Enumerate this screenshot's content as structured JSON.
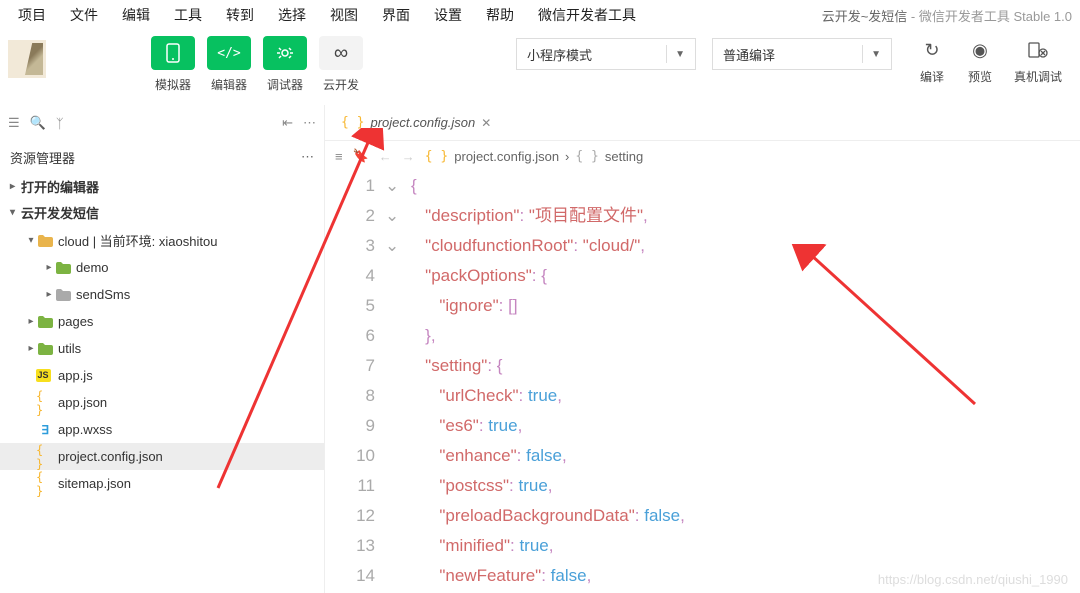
{
  "menu": [
    "项目",
    "文件",
    "编辑",
    "工具",
    "转到",
    "选择",
    "视图",
    "界面",
    "设置",
    "帮助",
    "微信开发者工具"
  ],
  "window_title": "云开发~发短信",
  "window_title_sub": " - 微信开发者工具 Stable 1.0",
  "toolbar": {
    "items": [
      {
        "icon": "phone",
        "label": "模拟器",
        "green": true
      },
      {
        "icon": "code",
        "label": "编辑器",
        "green": true
      },
      {
        "icon": "bug",
        "label": "调试器",
        "green": true
      },
      {
        "icon": "cloud",
        "label": "云开发",
        "green": false
      }
    ],
    "mode_dd": "小程序模式",
    "compile_dd": "普通编译",
    "actions": [
      "编译",
      "预览",
      "真机调试"
    ]
  },
  "explorer": {
    "title": "资源管理器",
    "sections": [
      {
        "label": "打开的编辑器",
        "expanded": false
      },
      {
        "label": "云开发发短信",
        "expanded": true
      }
    ],
    "tree": [
      {
        "d": 1,
        "chv": "▾",
        "ico": "folder",
        "label": "cloud | 当前环境: xiaoshitou"
      },
      {
        "d": 2,
        "chv": "▸",
        "ico": "folder-g",
        "label": "demo"
      },
      {
        "d": 2,
        "chv": "▸",
        "ico": "gray",
        "label": "sendSms"
      },
      {
        "d": 1,
        "chv": "▸",
        "ico": "folder-g",
        "label": "pages"
      },
      {
        "d": 1,
        "chv": "▸",
        "ico": "folder-g",
        "label": "utils"
      },
      {
        "d": 1,
        "chv": "",
        "ico": "js",
        "label": "app.js"
      },
      {
        "d": 1,
        "chv": "",
        "ico": "json",
        "label": "app.json"
      },
      {
        "d": 1,
        "chv": "",
        "ico": "wxss",
        "label": "app.wxss"
      },
      {
        "d": 1,
        "chv": "",
        "ico": "json",
        "label": "project.config.json",
        "sel": true
      },
      {
        "d": 1,
        "chv": "",
        "ico": "json",
        "label": "sitemap.json"
      }
    ]
  },
  "tab": {
    "icon": "{ }",
    "name": "project.config.json"
  },
  "breadcrumb": {
    "file": "project.config.json",
    "symbol_icon": "{ }",
    "symbol": "setting"
  },
  "code": {
    "lines": [
      {
        "n": 1,
        "fold": "⌄",
        "txt": [
          {
            "c": "p",
            "t": "{"
          }
        ]
      },
      {
        "n": 2,
        "txt": [
          {
            "c": "",
            "t": "   "
          },
          {
            "c": "s",
            "t": "\"description\""
          },
          {
            "c": "p",
            "t": ": "
          },
          {
            "c": "s",
            "t": "\"项目配置文件\""
          },
          {
            "c": "p",
            "t": ","
          }
        ]
      },
      {
        "n": 3,
        "txt": [
          {
            "c": "",
            "t": "   "
          },
          {
            "c": "s",
            "t": "\"cloudfunctionRoot\""
          },
          {
            "c": "p",
            "t": ": "
          },
          {
            "c": "s",
            "t": "\"cloud/\""
          },
          {
            "c": "p",
            "t": ","
          }
        ]
      },
      {
        "n": 4,
        "fold": "⌄",
        "txt": [
          {
            "c": "",
            "t": "   "
          },
          {
            "c": "s",
            "t": "\"packOptions\""
          },
          {
            "c": "p",
            "t": ": {"
          }
        ]
      },
      {
        "n": 5,
        "txt": [
          {
            "c": "",
            "t": "      "
          },
          {
            "c": "s",
            "t": "\"ignore\""
          },
          {
            "c": "p",
            "t": ": []"
          }
        ]
      },
      {
        "n": 6,
        "txt": [
          {
            "c": "",
            "t": "   "
          },
          {
            "c": "p",
            "t": "},"
          }
        ]
      },
      {
        "n": 7,
        "fold": "⌄",
        "txt": [
          {
            "c": "",
            "t": "   "
          },
          {
            "c": "s",
            "t": "\"setting\""
          },
          {
            "c": "p",
            "t": ": {"
          }
        ]
      },
      {
        "n": 8,
        "txt": [
          {
            "c": "",
            "t": "      "
          },
          {
            "c": "s",
            "t": "\"urlCheck\""
          },
          {
            "c": "p",
            "t": ": "
          },
          {
            "c": "b",
            "t": "true"
          },
          {
            "c": "p",
            "t": ","
          }
        ]
      },
      {
        "n": 9,
        "txt": [
          {
            "c": "",
            "t": "      "
          },
          {
            "c": "s",
            "t": "\"es6\""
          },
          {
            "c": "p",
            "t": ": "
          },
          {
            "c": "b",
            "t": "true"
          },
          {
            "c": "p",
            "t": ","
          }
        ]
      },
      {
        "n": 10,
        "txt": [
          {
            "c": "",
            "t": "      "
          },
          {
            "c": "s",
            "t": "\"enhance\""
          },
          {
            "c": "p",
            "t": ": "
          },
          {
            "c": "b",
            "t": "false"
          },
          {
            "c": "p",
            "t": ","
          }
        ]
      },
      {
        "n": 11,
        "txt": [
          {
            "c": "",
            "t": "      "
          },
          {
            "c": "s",
            "t": "\"postcss\""
          },
          {
            "c": "p",
            "t": ": "
          },
          {
            "c": "b",
            "t": "true"
          },
          {
            "c": "p",
            "t": ","
          }
        ]
      },
      {
        "n": 12,
        "txt": [
          {
            "c": "",
            "t": "      "
          },
          {
            "c": "s",
            "t": "\"preloadBackgroundData\""
          },
          {
            "c": "p",
            "t": ": "
          },
          {
            "c": "b",
            "t": "false"
          },
          {
            "c": "p",
            "t": ","
          }
        ]
      },
      {
        "n": 13,
        "txt": [
          {
            "c": "",
            "t": "      "
          },
          {
            "c": "s",
            "t": "\"minified\""
          },
          {
            "c": "p",
            "t": ": "
          },
          {
            "c": "b",
            "t": "true"
          },
          {
            "c": "p",
            "t": ","
          }
        ]
      },
      {
        "n": 14,
        "txt": [
          {
            "c": "",
            "t": "      "
          },
          {
            "c": "s",
            "t": "\"newFeature\""
          },
          {
            "c": "p",
            "t": ": "
          },
          {
            "c": "b",
            "t": "false"
          },
          {
            "c": "p",
            "t": ","
          }
        ]
      }
    ]
  },
  "watermark": "https://blog.csdn.net/qiushi_1990"
}
